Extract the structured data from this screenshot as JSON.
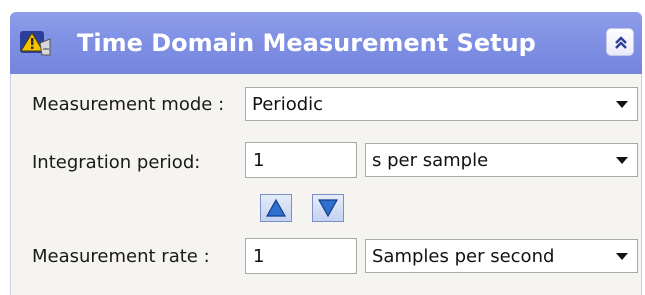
{
  "header": {
    "title": "Time Domain Measurement Setup",
    "icon": "measurement-setup-icon",
    "collapse_icon": "double-chevron-up-icon",
    "colors": {
      "header_bg": "#7e8fe3",
      "title": "#ffffff"
    }
  },
  "form": {
    "measurement_mode": {
      "label": "Measurement mode :",
      "value": "Periodic"
    },
    "integration_period": {
      "label": "Integration period:",
      "value": "1",
      "unit": "s per sample"
    },
    "spin_buttons": {
      "up_icon": "arrow-up-icon",
      "down_icon": "arrow-down-icon"
    },
    "measurement_rate": {
      "label": "Measurement rate :",
      "value": "1",
      "unit": "Samples per second"
    }
  }
}
